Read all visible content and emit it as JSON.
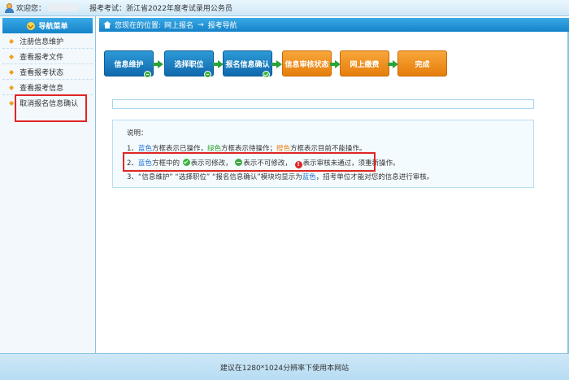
{
  "topbar": {
    "welcome": "欢迎您：",
    "exam_label": "报考考试：",
    "exam_name": "浙江省2022年度考试录用公务员"
  },
  "sidebar": {
    "header": "导航菜单",
    "items": [
      {
        "label": "注册信息维护"
      },
      {
        "label": "查看报考文件"
      },
      {
        "label": "查看报考状态"
      },
      {
        "label": "查看报考信息"
      },
      {
        "label": "取消报名信息确认"
      }
    ]
  },
  "breadcrumb": {
    "prefix": "您现在的位置:",
    "crumb1": "网上报名",
    "sep": "→",
    "crumb2": "报考导航"
  },
  "steps": [
    {
      "label": "信息维护",
      "color": "#1a7fc4",
      "status": "not-modifiable"
    },
    {
      "label": "选择职位",
      "color": "#1a7fc4",
      "status": "not-modifiable"
    },
    {
      "label": "报名信息确认",
      "color": "#1a7fc4",
      "status": "modifiable"
    },
    {
      "label": "信息审核状态",
      "color": "#f08c1c"
    },
    {
      "label": "网上缴费",
      "color": "#f08c1c"
    },
    {
      "label": "完成",
      "color": "#f08c1c"
    }
  ],
  "notes": {
    "title": "说明：",
    "line1": {
      "n": "1、",
      "blue": "蓝色",
      "t1": "方框表示已操作，",
      "green": "绿色",
      "t2": "方框表示待操作；",
      "orange": "橙色",
      "t3": "方框表示目前不能操作。"
    },
    "line2": {
      "n": "2、",
      "blue": "蓝色",
      "t1": "方框中的",
      "t2": "表示可修改，",
      "t3": "表示不可修改，",
      "red_mark": "!",
      "t4": "表示审核未通过，须重新操作。"
    },
    "line3": {
      "n": "3、",
      "t1": "“信息维护” “选择职位” “报名信息确认”模块均显示为",
      "blue": "蓝色",
      "t2": "，招考单位才能对您的信息进行审核。"
    }
  },
  "footer": {
    "text": "建议在1280*1024分辨率下使用本网站"
  },
  "colors": {
    "accent": "#1a8fd8",
    "highlight": "#e02525",
    "step_blue": "#1a7fc4",
    "step_orange": "#f08c1c",
    "arrow_green": "#2aa33a"
  }
}
